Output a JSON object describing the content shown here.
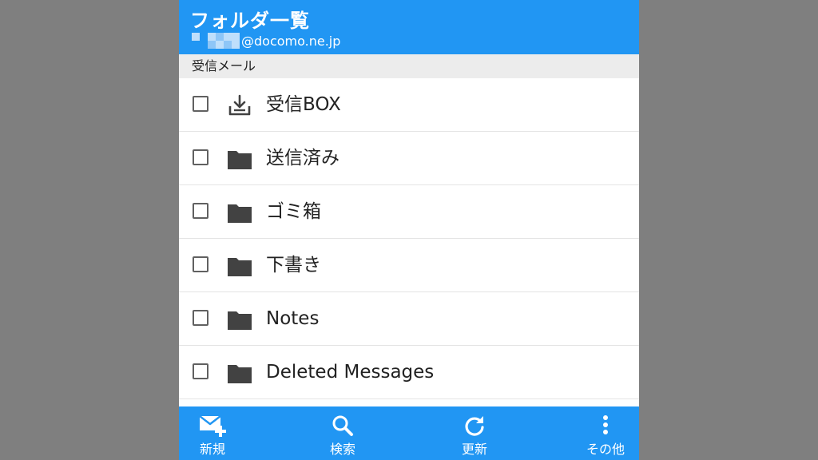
{
  "header": {
    "title": "フォルダ一覧",
    "account_email": "@docomo.ne.jp"
  },
  "section": {
    "label": "受信メール"
  },
  "folders": [
    {
      "label": "受信BOX",
      "icon": "inbox-download-icon",
      "checked": false
    },
    {
      "label": "送信済み",
      "icon": "folder-icon",
      "checked": false
    },
    {
      "label": "ゴミ箱",
      "icon": "folder-icon",
      "checked": false
    },
    {
      "label": "下書き",
      "icon": "folder-icon",
      "checked": false
    },
    {
      "label": "Notes",
      "icon": "folder-icon",
      "checked": false
    },
    {
      "label": "Deleted Messages",
      "icon": "folder-icon",
      "checked": false
    }
  ],
  "bottom_nav": [
    {
      "label": "新規",
      "icon": "new-mail-icon"
    },
    {
      "label": "検索",
      "icon": "search-icon"
    },
    {
      "label": "更新",
      "icon": "refresh-icon"
    },
    {
      "label": "その他",
      "icon": "more-vert-icon"
    }
  ],
  "colors": {
    "primary": "#2196f3",
    "section_bg": "#ececec",
    "icon_dark": "#424242",
    "backdrop": "#7f7f7f"
  }
}
